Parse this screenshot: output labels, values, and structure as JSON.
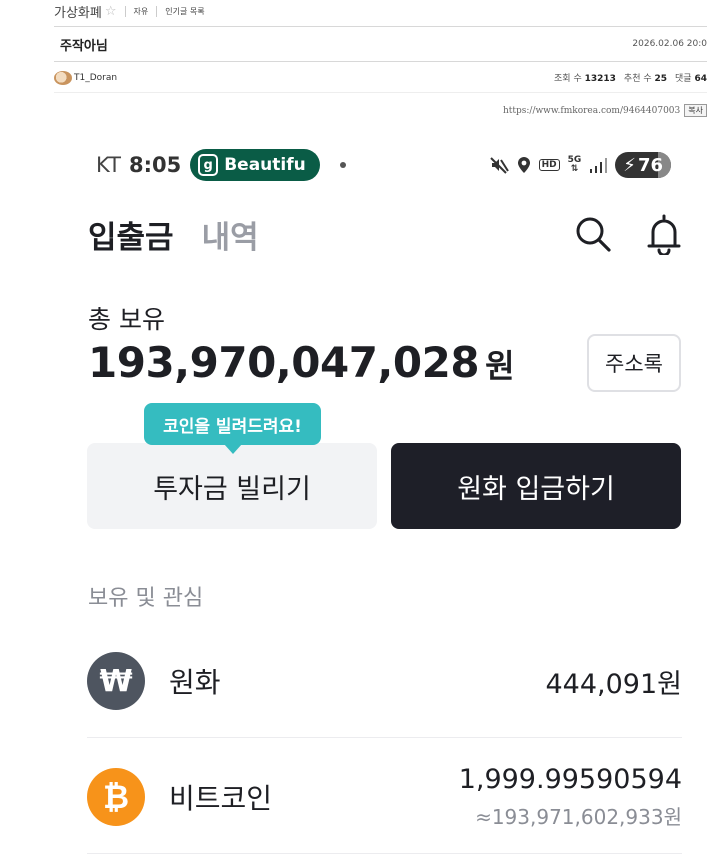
{
  "forum": {
    "board_name": "가상화폐",
    "star": "☆",
    "links": [
      "자유",
      "인기글 목록"
    ],
    "post_title": "주작아님",
    "post_date": "2026.02.06 20:0",
    "author": "T1_Doran",
    "views_label": "조회 수",
    "views": "13213",
    "likes_label": "추천 수",
    "likes": "25",
    "comments_label": "댓글",
    "comments": "64",
    "url": "https://www.fmkorea.com/9464407003",
    "copy_label": "복사"
  },
  "status_bar": {
    "carrier": "KT",
    "time": "8:05",
    "app_icon_letter": "g",
    "app_pill": "Beautifu",
    "battery": "76",
    "battery_level": 0.76
  },
  "header": {
    "tabs": [
      {
        "label": "입출금",
        "active": true
      },
      {
        "label": "내역",
        "active": false
      }
    ]
  },
  "total": {
    "label": "총 보유",
    "amount": "193,970,047,028",
    "unit": "원",
    "address_book_label": "주소록"
  },
  "actions": {
    "tooltip": "코인을 빌려드려요!",
    "borrow_label": "투자금 빌리기",
    "deposit_label": "원화 입금하기"
  },
  "holdings": {
    "section_label": "보유 및 관심",
    "items": [
      {
        "icon": "krw-icon",
        "icon_glyph": "₩",
        "name": "원화",
        "amount": "444,091원",
        "sub": ""
      },
      {
        "icon": "bitcoin-icon",
        "icon_glyph": "₿",
        "name": "비트코인",
        "amount": "1,999.99590594",
        "sub": "≈193,971,602,933원"
      }
    ]
  },
  "colors": {
    "accent_green": "#0a5c46",
    "tooltip_teal": "#35bcc0",
    "deposit_dark": "#1e1f28",
    "bitcoin_orange": "#f7931a"
  }
}
